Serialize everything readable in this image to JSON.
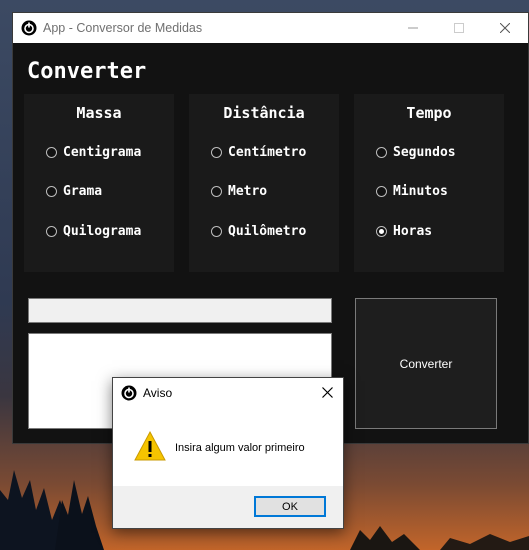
{
  "window": {
    "title": "App - Conversor de Medidas",
    "controls": {
      "minimize_icon": "minimize-icon",
      "maximize_icon": "maximize-icon",
      "close_icon": "close-icon"
    }
  },
  "heading": "Converter",
  "groups": [
    {
      "title": "Massa",
      "options": [
        "Centigrama",
        "Grama",
        "Quilograma"
      ],
      "selected": null
    },
    {
      "title": "Distância",
      "options": [
        "Centímetro",
        "Metro",
        "Quilômetro"
      ],
      "selected": null
    },
    {
      "title": "Tempo",
      "options": [
        "Segundos",
        "Minutos",
        "Horas"
      ],
      "selected": "Horas"
    }
  ],
  "input": {
    "value": "",
    "placeholder": ""
  },
  "result": {
    "text": ""
  },
  "convert_button": {
    "label": "Converter"
  },
  "dialog": {
    "title": "Aviso",
    "message": "Insira algum valor primeiro",
    "ok_label": "OK",
    "icon": "warning-icon"
  },
  "colors": {
    "window_bg": "#121212",
    "group_bg": "#1a1a1a",
    "accent": "#0078d7",
    "warning": "#f5c400"
  }
}
